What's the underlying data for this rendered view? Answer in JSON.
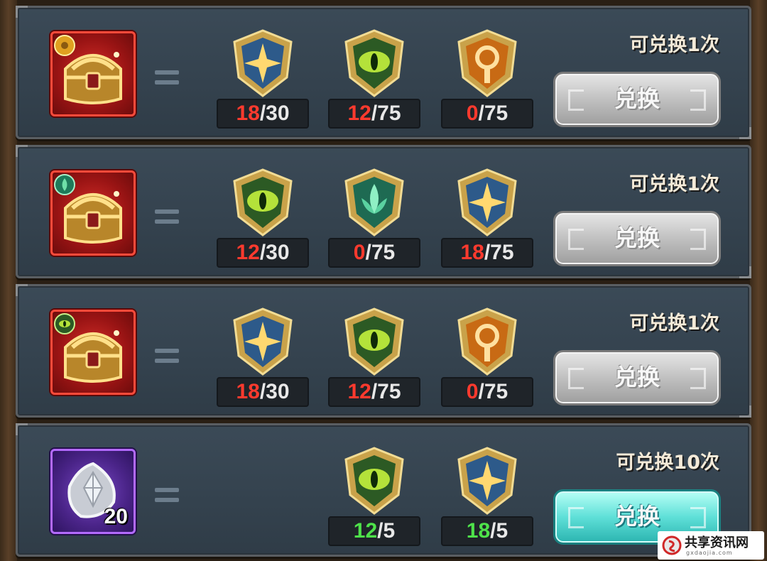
{
  "button_label": "兑换",
  "rows": [
    {
      "reward": {
        "type": "chest",
        "badge": "gold-gear-badge",
        "count": ""
      },
      "availability": "可兑换1次",
      "button_enabled": false,
      "materials": [
        {
          "icon": "star-shield-icon",
          "have": "18",
          "need": "/30",
          "enough": false
        },
        {
          "icon": "eye-shield-icon",
          "have": "12",
          "need": "/75",
          "enough": false
        },
        {
          "icon": "ring-shield-icon",
          "have": "0",
          "need": "/75",
          "enough": false
        }
      ]
    },
    {
      "reward": {
        "type": "chest",
        "badge": "lotus-badge",
        "count": ""
      },
      "availability": "可兑换1次",
      "button_enabled": false,
      "materials": [
        {
          "icon": "eye-shield-icon",
          "have": "12",
          "need": "/30",
          "enough": false
        },
        {
          "icon": "lotus-shield-icon",
          "have": "0",
          "need": "/75",
          "enough": false
        },
        {
          "icon": "star-shield-icon",
          "have": "18",
          "need": "/75",
          "enough": false
        }
      ]
    },
    {
      "reward": {
        "type": "chest",
        "badge": "eye-badge",
        "count": ""
      },
      "availability": "可兑换1次",
      "button_enabled": false,
      "materials": [
        {
          "icon": "star-shield-icon",
          "have": "18",
          "need": "/30",
          "enough": false
        },
        {
          "icon": "eye-shield-icon",
          "have": "12",
          "need": "/75",
          "enough": false
        },
        {
          "icon": "ring-shield-icon",
          "have": "0",
          "need": "/75",
          "enough": false
        }
      ]
    },
    {
      "reward": {
        "type": "gem",
        "badge": "",
        "count": "20"
      },
      "availability": "可兑换10次",
      "button_enabled": true,
      "materials": [
        {
          "icon": "eye-shield-icon",
          "have": "12",
          "need": "/5",
          "enough": true
        },
        {
          "icon": "star-shield-icon",
          "have": "18",
          "need": "/5",
          "enough": true
        }
      ]
    }
  ],
  "watermark": {
    "text": "共享资讯网",
    "sub": "gxdaojia.com"
  },
  "colors": {
    "insufficient": "#ff3a2e",
    "sufficient": "#4ee24a",
    "button_active": "#5fe0d8",
    "button_disabled": "#bdbdbd"
  }
}
